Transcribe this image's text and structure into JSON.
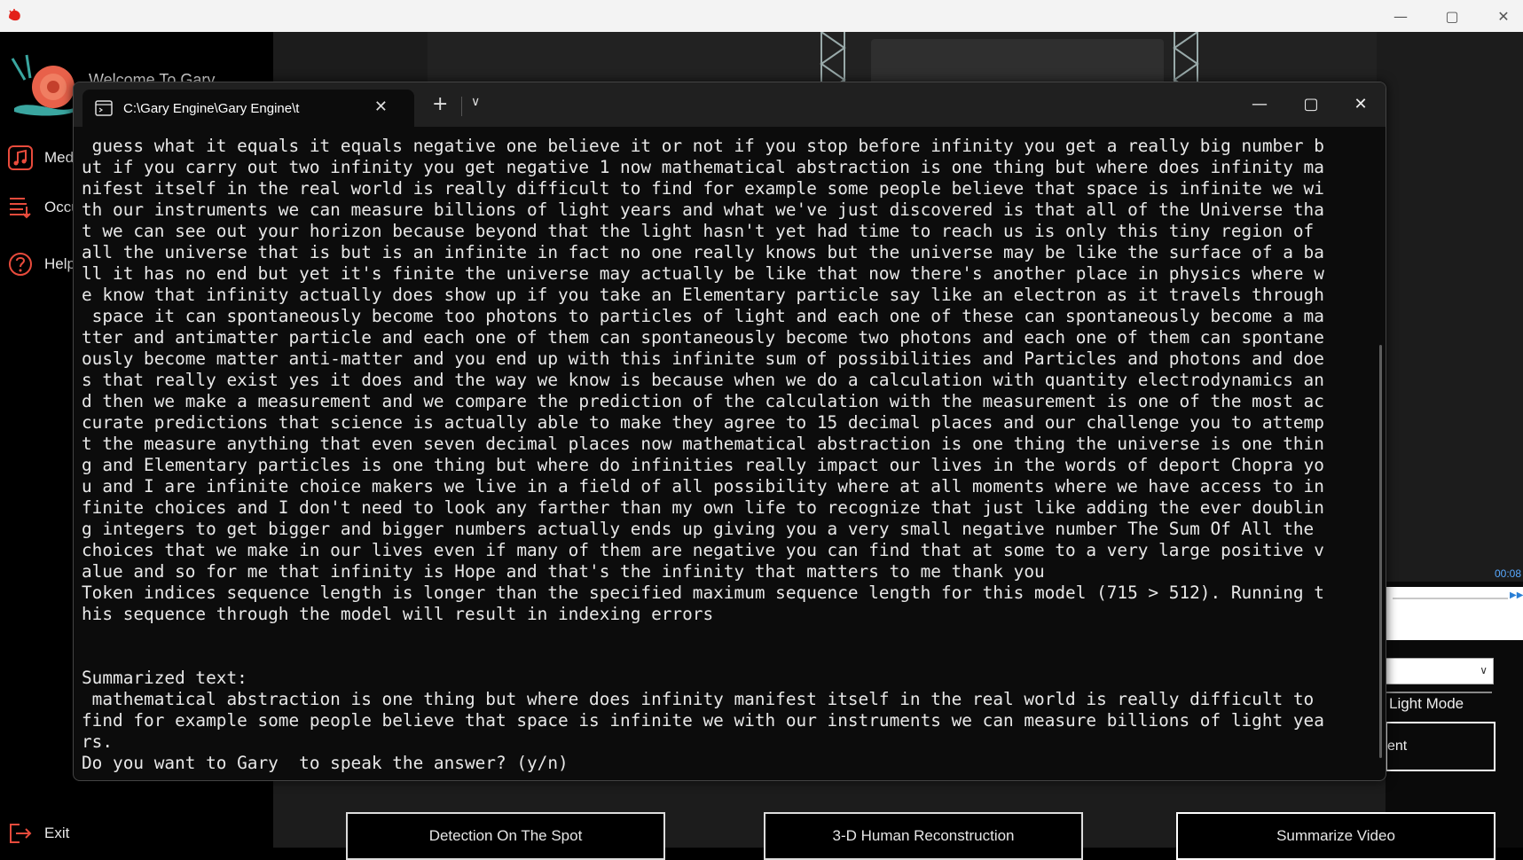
{
  "app": {
    "welcome": "Welcome To Gary",
    "sidebar": [
      {
        "label": "Media",
        "icon": "music-icon"
      },
      {
        "label": "Occupancy",
        "icon": "list-icon"
      },
      {
        "label": "Help",
        "icon": "help-icon"
      }
    ],
    "exit_label": "Exit",
    "time": "00:08",
    "light_mode": "Light Mode",
    "partial_button": "ent",
    "buttons": {
      "detect": "Detection On The Spot",
      "recon": "3-D Human Reconstruction",
      "summarize": "Summarize Video"
    },
    "colors": {
      "accent": "#e84b3c",
      "link": "#58a9ff"
    }
  },
  "terminal": {
    "tab_title": "C:\\Gary Engine\\Gary Engine\\t",
    "lines": [
      " guess what it equals it equals negative one believe it or not if you stop before infinity you get a really big number b",
      "ut if you carry out two infinity you get negative 1 now mathematical abstraction is one thing but where does infinity ma",
      "nifest itself in the real world is really difficult to find for example some people believe that space is infinite we wi",
      "th our instruments we can measure billions of light years and what we've just discovered is that all of the Universe tha",
      "t we can see out your horizon because beyond that the light hasn't yet had time to reach us is only this tiny region of",
      "all the universe that is but is an infinite in fact no one really knows but the universe may be like the surface of a ba",
      "ll it has no end but yet it's finite the universe may actually be like that now there's another place in physics where w",
      "e know that infinity actually does show up if you take an Elementary particle say like an electron as it travels through",
      " space it can spontaneously become too photons to particles of light and each one of these can spontaneously become a ma",
      "tter and antimatter particle and each one of them can spontaneously become two photons and each one of them can spontane",
      "ously become matter anti-matter and you end up with this infinite sum of possibilities and Particles and photons and doe",
      "s that really exist yes it does and the way we know is because when we do a calculation with quantity electrodynamics an",
      "d then we make a measurement and we compare the prediction of the calculation with the measurement is one of the most ac",
      "curate predictions that science is actually able to make they agree to 15 decimal places and our challenge you to attemp",
      "t the measure anything that even seven decimal places now mathematical abstraction is one thing the universe is one thin",
      "g and Elementary particles is one thing but where do infinities really impact our lives in the words of deport Chopra yo",
      "u and I are infinite choice makers we live in a field of all possibility where at all moments where we have access to in",
      "finite choices and I don't need to look any farther than my own life to recognize that just like adding the ever doublin",
      "g integers to get bigger and bigger numbers actually ends up giving you a very small negative number The Sum Of All the",
      "choices that we make in our lives even if many of them are negative you can find that at some to a very large positive v",
      "alue and so for me that infinity is Hope and that's the infinity that matters to me thank you",
      "Token indices sequence length is longer than the specified maximum sequence length for this model (715 > 512). Running t",
      "his sequence through the model will result in indexing errors",
      "",
      "",
      "Summarized text:",
      " mathematical abstraction is one thing but where does infinity manifest itself in the real world is really difficult to",
      "find for example some people believe that space is infinite we with our instruments we can measure billions of light yea",
      "rs.",
      "Do you want to Gary  to speak the answer? (y/n)"
    ]
  }
}
